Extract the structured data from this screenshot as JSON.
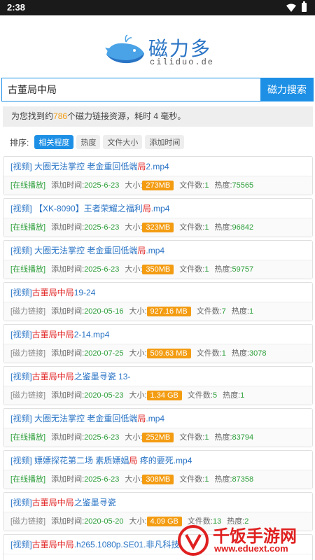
{
  "status_bar": {
    "time": "2:38"
  },
  "logo": {
    "title": "磁力多",
    "subtitle": "ciliduo.de"
  },
  "search": {
    "value": "古董局中局",
    "button_label": "磁力搜索"
  },
  "result_info": {
    "prefix": "为您找到约",
    "count": "786",
    "suffix": "个磁力链接资源，耗时 4 毫秒。"
  },
  "sort": {
    "label": "排序:",
    "options": [
      "相关程度",
      "热度",
      "文件大小",
      "添加时间"
    ]
  },
  "labels": {
    "added": "添加时间:",
    "size": "大小:",
    "files": "文件数:",
    "heat": "热度:"
  },
  "results": [
    {
      "title_pre": "[视频] 大圈无法掌控 老金重回低端",
      "title_hl": "局",
      "title_post": "2.mp4",
      "type": "[在线播放]",
      "date": "2025-6-23",
      "size": "273MB",
      "files": "1",
      "heat": "75565"
    },
    {
      "title_pre": "[视频] 【XK-8090】王者荣耀之福利",
      "title_hl": "局",
      "title_post": ".mp4",
      "type": "[在线播放]",
      "date": "2025-6-23",
      "size": "323MB",
      "files": "1",
      "heat": "96842"
    },
    {
      "title_pre": "[视频] 大圈无法掌控 老金重回低端",
      "title_hl": "局",
      "title_post": ".mp4",
      "type": "[在线播放]",
      "date": "2025-6-23",
      "size": "350MB",
      "files": "1",
      "heat": "59757"
    },
    {
      "title_pre": "[视频]",
      "title_hl": "古董局中局",
      "title_post": "19-24",
      "type": "[磁力链接]",
      "date": "2020-05-16",
      "size": "927.16 MB",
      "files": "7",
      "heat": "1"
    },
    {
      "title_pre": "[视频]",
      "title_hl": "古董局中局",
      "title_post": "2-14.mp4",
      "type": "[磁力链接]",
      "date": "2020-07-25",
      "size": "509.63 MB",
      "files": "1",
      "heat": "3078"
    },
    {
      "title_pre": "[视频]",
      "title_hl": "古董局中局",
      "title_post": "之鉴墨寻瓷 13-",
      "type": "[磁力链接]",
      "date": "2020-05-23",
      "size": "1.34 GB",
      "files": "5",
      "heat": "1"
    },
    {
      "title_pre": "[视频] 大圈无法掌控 老金重回低端",
      "title_hl": "局",
      "title_post": ".mp4",
      "type": "[在线播放]",
      "date": "2025-6-23",
      "size": "252MB",
      "files": "1",
      "heat": "83794"
    },
    {
      "title_pre": "[视频] 嫖嫖探花第二场 素质嫖娼",
      "title_hl": "局",
      "title_post": " 疼的要死.mp4",
      "type": "[在线播放]",
      "date": "2025-6-23",
      "size": "308MB",
      "files": "1",
      "heat": "87358"
    },
    {
      "title_pre": "[视频]",
      "title_hl": "古董局中局",
      "title_post": "之鉴墨寻瓷",
      "type": "[磁力链接]",
      "date": "2020-05-20",
      "size": "4.09 GB",
      "files": "13",
      "heat": "2"
    },
    {
      "title_pre": "[视频]",
      "title_hl": "古董局中局",
      "title_post": ".h265.1080p.SE01.非凡科技",
      "type": "",
      "date": "",
      "size": "",
      "files": "",
      "heat": ""
    }
  ],
  "watermark": {
    "title": "千饭手游网",
    "url": "www.eduext.com"
  },
  "colors": {
    "accent": "#1d90e6",
    "highlight": "#e02020",
    "size_badge": "#f39c12",
    "green": "#2d9f3a"
  }
}
